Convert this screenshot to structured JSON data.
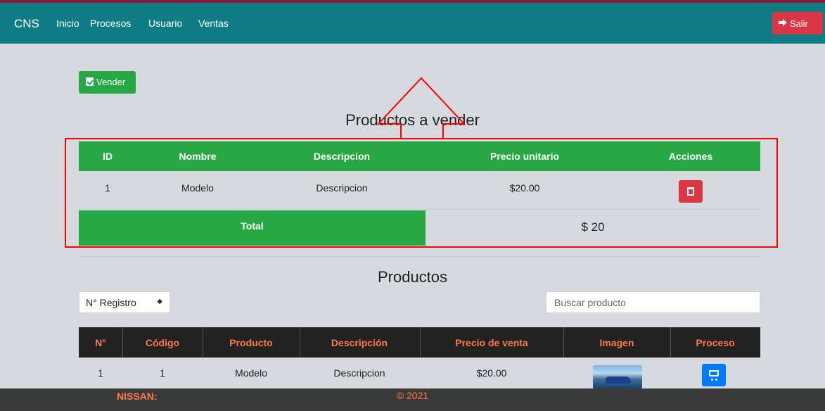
{
  "navbar": {
    "brand": "CNS",
    "links": [
      "Inicio",
      "Procesos",
      "Usuario",
      "Ventas"
    ],
    "logout_label": "Salir",
    "logout_icon": "sign-out-icon"
  },
  "actions": {
    "sell_label": "Vender",
    "sell_icon": "clipboard-check-icon"
  },
  "cart": {
    "title": "Productos a vender",
    "columns": [
      "ID",
      "Nombre",
      "Descripcion",
      "Precio unitario",
      "Acciones"
    ],
    "rows": [
      {
        "id": "1",
        "name": "Modelo",
        "description": "Descripcion",
        "unit_price": "$20.00"
      }
    ],
    "delete_icon": "trash-icon",
    "total_label": "Total",
    "total_value": "$ 20"
  },
  "products": {
    "title": "Productos",
    "filter_selected": "N° Registro",
    "search_placeholder": "Buscar producto",
    "columns": [
      "N°",
      "Código",
      "Producto",
      "Descripción",
      "Precio de venta",
      "Imagen",
      "Proceso"
    ],
    "rows": [
      {
        "num": "1",
        "code": "1",
        "product": "Modelo",
        "description": "Descripcion",
        "price": "$20.00"
      }
    ],
    "cart_icon": "cart-icon"
  },
  "footer": {
    "brand": "NISSAN:",
    "copyright": "© 2021"
  },
  "colors": {
    "navbar": "#0f7d83",
    "success": "#28a745",
    "danger": "#dc3545",
    "primary": "#007bff",
    "table_dark": "#222222",
    "accent_orange": "#ff7a45",
    "annotation_red": "#ff0000"
  }
}
